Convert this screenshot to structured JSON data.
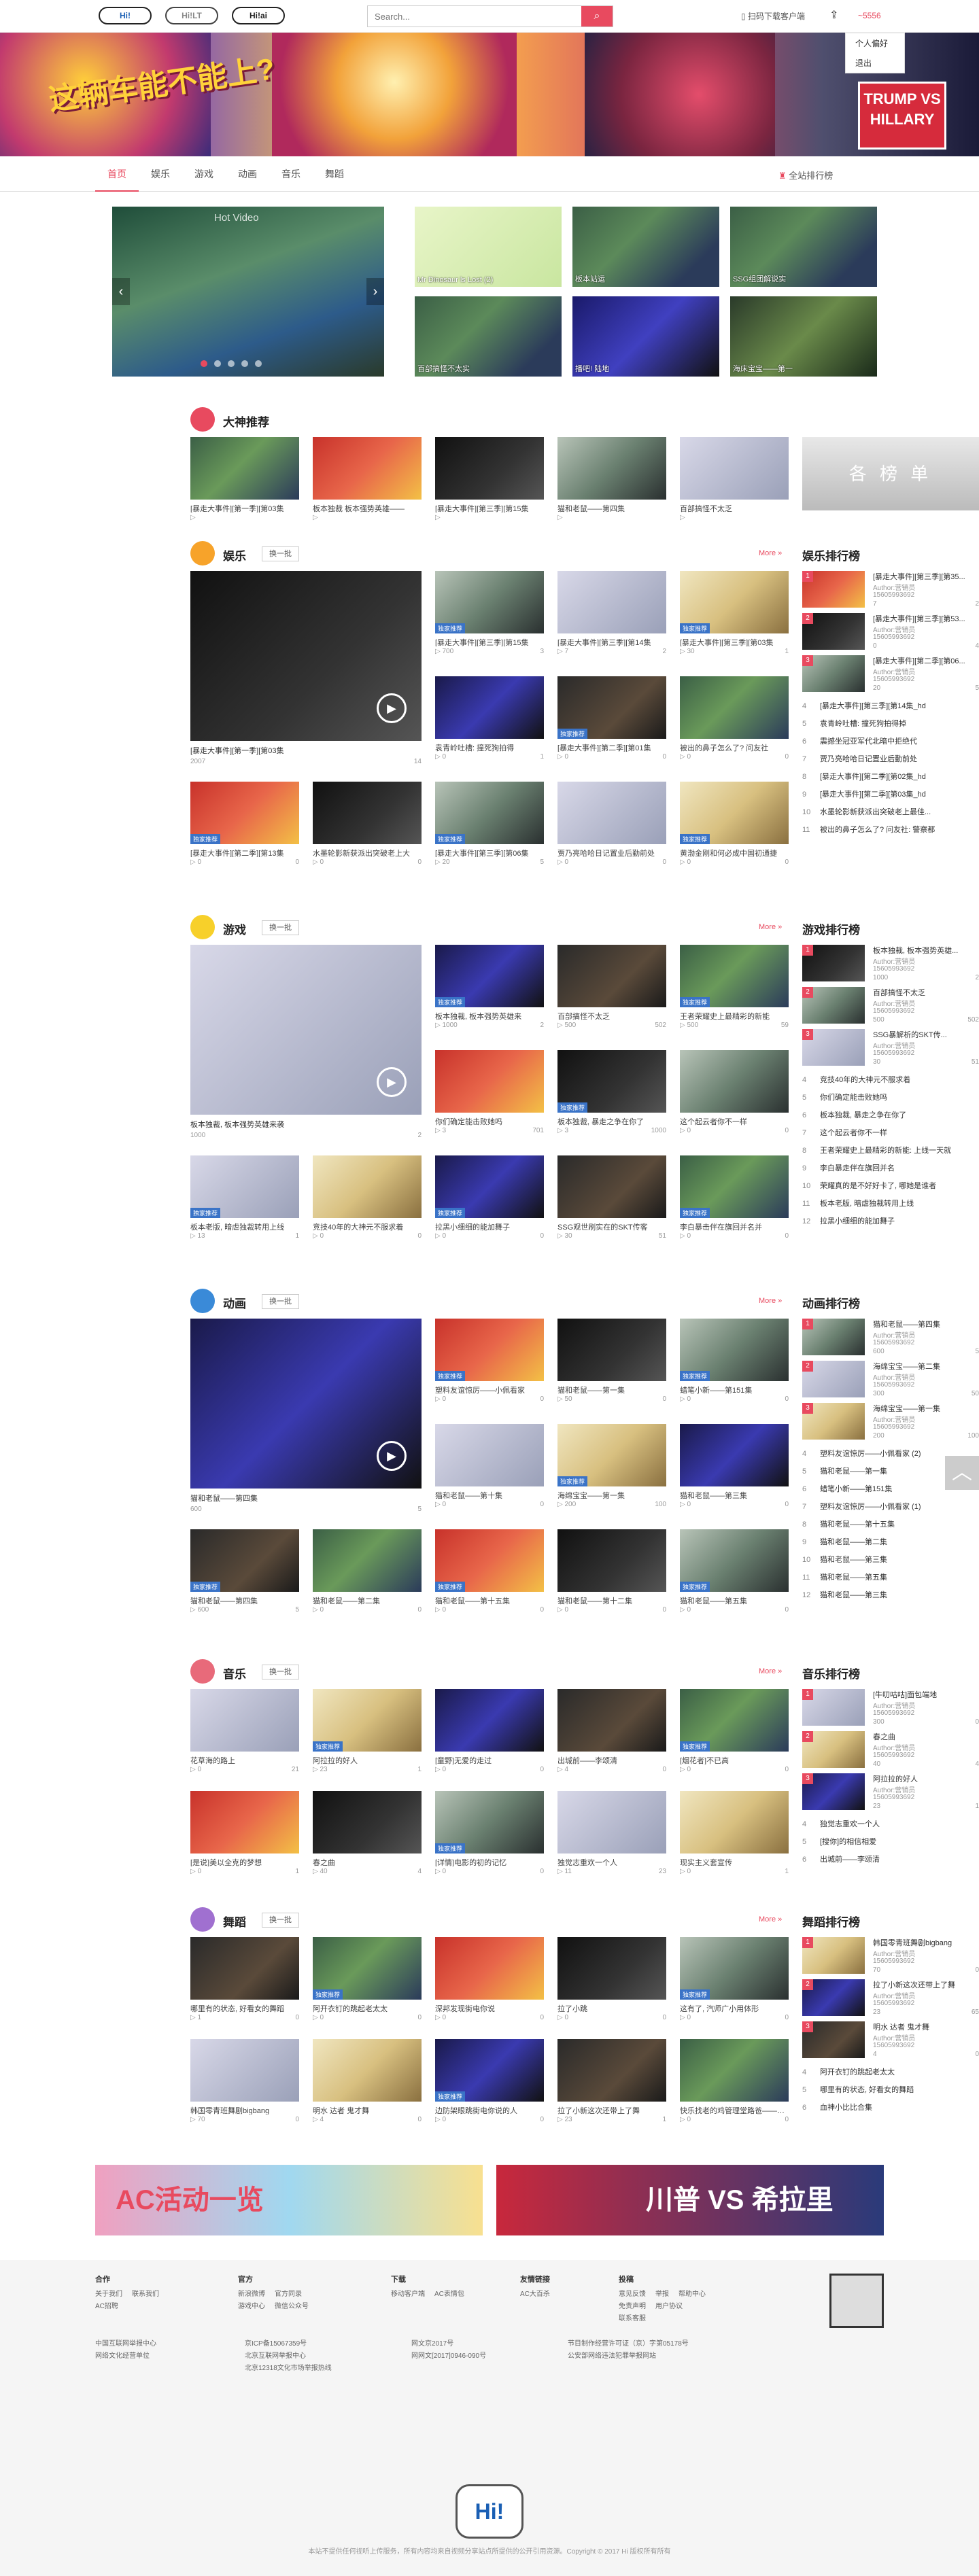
{
  "header": {
    "logos": [
      "Hi!",
      "Hi!LT",
      "Hi!ai"
    ],
    "search_placeholder": "Search...",
    "download_label": "扫码下载客户端",
    "upload_icon": "upload-icon",
    "username": "~5556",
    "user_menu": [
      "个人偏好",
      "退出"
    ]
  },
  "banner": {
    "title": "这辆车能不能上?",
    "tag": "TRUMP VS HILLARY"
  },
  "nav": {
    "items": [
      "首页",
      "娱乐",
      "游戏",
      "动画",
      "音乐",
      "舞蹈"
    ],
    "rank_all": "全站排行榜"
  },
  "hot": {
    "carousel_label": "Hot Video",
    "tiles": [
      {
        "caption": "Mr Dinosaur ls Lost (2)"
      },
      {
        "caption": "板本站运"
      },
      {
        "caption": "SSG组团解说实"
      },
      {
        "caption": "百部搞怪不太实"
      },
      {
        "caption": "播吧! 陆地"
      },
      {
        "caption": "海床宝宝——第一"
      }
    ]
  },
  "sections": [
    {
      "key": "dashen",
      "title": "大神推荐",
      "icon": "avatar-icon",
      "cards": [
        {
          "t": "[暴走大事件][第一季][第03集",
          "m1": "",
          "m2": ""
        },
        {
          "t": "板本独裁 板本强势英雄——",
          "m1": "",
          "m2": ""
        },
        {
          "t": "[暴走大事件][第三季][第15集",
          "m1": "",
          "m2": ""
        },
        {
          "t": "猫和老鼠——第四集",
          "m1": "",
          "m2": ""
        },
        {
          "t": "百部搞怪不太乏",
          "m1": "",
          "m2": ""
        }
      ],
      "ad_label": "各 榜 单"
    },
    {
      "key": "yule",
      "title": "娱乐",
      "refresh": "换一批",
      "more": "More »",
      "rank_title": "娱乐排行榜",
      "big": {
        "t": "[暴走大事件][第一季][第03集",
        "views": "2007",
        "comments": "14"
      },
      "cards": [
        {
          "t": "[暴走大事件][第三季][第15集",
          "m1": "700",
          "m2": "3"
        },
        {
          "t": "[暴走大事件][第三季][第14集",
          "m1": "7",
          "m2": "2"
        },
        {
          "t": "[暴走大事件][第三季][第03集",
          "m1": "30",
          "m2": "1"
        },
        {
          "t": "袁青岭吐槽: 撞死狗拍得",
          "m1": "0",
          "m2": "1"
        },
        {
          "t": "[暴走大事件][第二季][第01集",
          "m1": "0",
          "m2": "0"
        },
        {
          "t": "被出的鼻子怎么了? 问友社",
          "m1": "0",
          "m2": "0"
        },
        {
          "t": "[暴走大事件][第二季][第13集",
          "m1": "0",
          "m2": "0"
        },
        {
          "t": "水墨轮影新获派出突破老上大",
          "m1": "0",
          "m2": "0"
        },
        {
          "t": "[暴走大事件][第三季][第06集",
          "m1": "20",
          "m2": "5"
        },
        {
          "t": "贾乃亮哈哈日记置业后勤前处",
          "m1": "0",
          "m2": "0"
        },
        {
          "t": "黄渤金刚和何必成中国初通捷",
          "m1": "0",
          "m2": "0"
        }
      ],
      "rank": {
        "top": [
          {
            "t": "[暴走大事件][第三季][第35...",
            "au": "Author:营销员",
            "pl": "15605993692",
            "pv": "7",
            "cm": "2"
          },
          {
            "t": "[暴走大事件][第三季][第53...",
            "au": "Author:营销员",
            "pl": "15605993692",
            "pv": "0",
            "cm": "4"
          },
          {
            "t": "[暴走大事件][第二季][第06...",
            "au": "Author:营销员",
            "pl": "15605993692",
            "pv": "20",
            "cm": "5"
          }
        ],
        "rows": [
          {
            "n": "4",
            "t": "[暴走大事件][第三季][第14集_hd"
          },
          {
            "n": "5",
            "t": "袁青岭吐槽: 撞死狗拍得掉"
          },
          {
            "n": "6",
            "t": "震撼坐冠亚军代北暗中拒绝代"
          },
          {
            "n": "7",
            "t": "贾乃亮哈哈日记置业后勤前处"
          },
          {
            "n": "8",
            "t": "[暴走大事件][第二季][第02集_hd"
          },
          {
            "n": "9",
            "t": "[暴走大事件][第二季][第03集_hd"
          },
          {
            "n": "10",
            "t": "水墨轮影新获派出突破老上最佳..."
          },
          {
            "n": "11",
            "t": "被出的鼻子怎么了? 问友社: 警察都"
          }
        ]
      }
    },
    {
      "key": "youxi",
      "title": "游戏",
      "refresh": "换一批",
      "more": "More »",
      "rank_title": "游戏排行榜",
      "big": {
        "t": "板本独裁, 板本强势英雄来袭",
        "views": "1000",
        "comments": "2"
      },
      "cards": [
        {
          "t": "板本独裁, 板本强势英雄来",
          "m1": "1000",
          "m2": "2"
        },
        {
          "t": "百部搞怪不太乏",
          "m1": "500",
          "m2": "502"
        },
        {
          "t": "王者荣耀史上最精彩的新能",
          "m1": "500",
          "m2": "59"
        },
        {
          "t": "你们确定能击败她吗",
          "m1": "3",
          "m2": "701"
        },
        {
          "t": "板本独裁, 暴走之争在你了",
          "m1": "3",
          "m2": "1000"
        },
        {
          "t": "这个起云者你不一样",
          "m1": "0",
          "m2": "0"
        },
        {
          "t": "板本老版, 暗虐独裁转用上线",
          "m1": "13",
          "m2": "1"
        },
        {
          "t": "竞技40年的大神元不服求着",
          "m1": "0",
          "m2": "0"
        },
        {
          "t": "拉黑小细细的能加舞子",
          "m1": "0",
          "m2": "0"
        },
        {
          "t": "SSG观世刷实在的SKT传客",
          "m1": "30",
          "m2": "51"
        },
        {
          "t": "李白暴击伴在旗回并名并",
          "m1": "0",
          "m2": "0"
        }
      ],
      "rank": {
        "top": [
          {
            "t": "板本独裁, 板本强势英雄...",
            "au": "Author:营销员",
            "pl": "15605993692",
            "pv": "1000",
            "cm": "2"
          },
          {
            "t": "百部搞怪不太乏",
            "au": "Author:营销员",
            "pl": "15605993692",
            "pv": "500",
            "cm": "502"
          },
          {
            "t": "SSG暴解析的SKT传...",
            "au": "Author:营销员",
            "pl": "15605993692",
            "pv": "30",
            "cm": "51"
          }
        ],
        "rows": [
          {
            "n": "4",
            "t": "竞技40年的大神元不服求着"
          },
          {
            "n": "5",
            "t": "你们确定能击败她吗"
          },
          {
            "n": "6",
            "t": "板本独裁, 暴走之争在你了"
          },
          {
            "n": "7",
            "t": "这个起云者你不一样"
          },
          {
            "n": "8",
            "t": "王者荣耀史上最精彩的新能: 上线一天就"
          },
          {
            "n": "9",
            "t": "李白暴走伴在旗回并名"
          },
          {
            "n": "10",
            "t": "荣耀真的是不好好卡了, 哪她是谁者"
          },
          {
            "n": "11",
            "t": "板本老版, 暗虐独裁转用上线"
          },
          {
            "n": "12",
            "t": "拉黑小细细的能加舞子"
          }
        ]
      }
    },
    {
      "key": "donghua",
      "title": "动画",
      "refresh": "换一批",
      "more": "More »",
      "rank_title": "动画排行榜",
      "big": {
        "t": "猫和老鼠——第四集",
        "views": "600",
        "comments": "5"
      },
      "cards": [
        {
          "t": "塑料友谊惊厉——小佩看家",
          "m1": "0",
          "m2": "0"
        },
        {
          "t": "猫和老鼠——第一集",
          "m1": "50",
          "m2": "0"
        },
        {
          "t": "蜡笔小新——第151集",
          "m1": "0",
          "m2": "0"
        },
        {
          "t": "猫和老鼠——第十集",
          "m1": "0",
          "m2": "0"
        },
        {
          "t": "海绵宝宝——第一集",
          "m1": "200",
          "m2": "100"
        },
        {
          "t": "猫和老鼠——第三集",
          "m1": "0",
          "m2": "0"
        },
        {
          "t": "猫和老鼠——第四集",
          "m1": "600",
          "m2": "5"
        },
        {
          "t": "猫和老鼠——第二集",
          "m1": "0",
          "m2": "0"
        },
        {
          "t": "猫和老鼠——第十五集",
          "m1": "0",
          "m2": "0"
        },
        {
          "t": "猫和老鼠——第十二集",
          "m1": "0",
          "m2": "0"
        },
        {
          "t": "猫和老鼠——第五集",
          "m1": "0",
          "m2": "0"
        }
      ],
      "rank": {
        "top": [
          {
            "t": "猫和老鼠——第四集",
            "au": "Author:营销员",
            "pl": "15605993692",
            "pv": "600",
            "cm": "5"
          },
          {
            "t": "海绵宝宝——第二集",
            "au": "Author:营销员",
            "pl": "15605993692",
            "pv": "300",
            "cm": "50"
          },
          {
            "t": "海绵宝宝——第一集",
            "au": "Author:营销员",
            "pl": "15605993692",
            "pv": "200",
            "cm": "100"
          }
        ],
        "rows": [
          {
            "n": "4",
            "t": "塑料友谊惊厉——小佩看家 (2)"
          },
          {
            "n": "5",
            "t": "猫和老鼠——第一集"
          },
          {
            "n": "6",
            "t": "蜡笔小新——第151集"
          },
          {
            "n": "7",
            "t": "塑料友谊惊厉——小佩看家 (1)"
          },
          {
            "n": "8",
            "t": "猫和老鼠——第十五集"
          },
          {
            "n": "9",
            "t": "猫和老鼠——第二集"
          },
          {
            "n": "10",
            "t": "猫和老鼠——第三集"
          },
          {
            "n": "11",
            "t": "猫和老鼠——第五集"
          },
          {
            "n": "12",
            "t": "猫和老鼠——第三集"
          }
        ]
      }
    },
    {
      "key": "yinyue",
      "title": "音乐",
      "refresh": "换一批",
      "more": "More »",
      "rank_title": "音乐排行榜",
      "cards": [
        {
          "t": "花草海的路上",
          "m1": "0",
          "m2": "21"
        },
        {
          "t": "阿拉拉的好人",
          "m1": "23",
          "m2": "1"
        },
        {
          "t": "[童野]无爱的走过",
          "m1": "0",
          "m2": "0"
        },
        {
          "t": "出城前——李颂清",
          "m1": "4",
          "m2": "0"
        },
        {
          "t": "[烟花者]不已高",
          "m1": "0",
          "m2": "0"
        },
        {
          "t": "[是说]美以全克的梦想",
          "m1": "0",
          "m2": "1"
        },
        {
          "t": "春之曲",
          "m1": "40",
          "m2": "4"
        },
        {
          "t": "[详情]电影的初的记忆",
          "m1": "0",
          "m2": "0"
        },
        {
          "t": "独觉志重欢一个人",
          "m1": "11",
          "m2": "23"
        },
        {
          "t": "现实主义套宣传",
          "m1": "0",
          "m2": "1"
        }
      ],
      "rank": {
        "top": [
          {
            "t": "[牛叨咕咕]面包端地",
            "au": "Author:营销员",
            "pl": "15605993692",
            "pv": "300",
            "cm": "0"
          },
          {
            "t": "春之曲",
            "au": "Author:营销员",
            "pl": "15605993692",
            "pv": "40",
            "cm": "4"
          },
          {
            "t": "阿拉拉的好人",
            "au": "Author:营销员",
            "pl": "15605993692",
            "pv": "23",
            "cm": "1"
          }
        ],
        "rows": [
          {
            "n": "4",
            "t": "独觉志重欢一个人"
          },
          {
            "n": "5",
            "t": "[搜你]的相信相爱"
          },
          {
            "n": "6",
            "t": "出城前——李颂清"
          }
        ]
      }
    },
    {
      "key": "wudao",
      "title": "舞蹈",
      "refresh": "换一批",
      "more": "More »",
      "rank_title": "舞蹈排行榜",
      "cards": [
        {
          "t": "哪里有的状态, 好看女的舞蹈",
          "m1": "1",
          "m2": "0"
        },
        {
          "t": "阿开衣钉的跳起老太太",
          "m1": "0",
          "m2": "0"
        },
        {
          "t": "深邦发现街电你说",
          "m1": "0",
          "m2": "0"
        },
        {
          "t": "拉了小跳",
          "m1": "0",
          "m2": "0"
        },
        {
          "t": "这有了, 汽师广小用体形",
          "m1": "0",
          "m2": "0"
        },
        {
          "t": "韩国零青班舞剧bigbang",
          "m1": "70",
          "m2": "0"
        },
        {
          "t": "明水 达者 鬼才舞",
          "m1": "4",
          "m2": "0"
        },
        {
          "t": "边防架眼跳街电你说的人",
          "m1": "0",
          "m2": "0"
        },
        {
          "t": "拉了小新这次还带上了舞",
          "m1": "23",
          "m2": "1"
        },
        {
          "t": "快乐找老的鸡管理堂路爸——第一集",
          "m1": "0",
          "m2": "0"
        }
      ],
      "rank": {
        "top": [
          {
            "t": "韩国零青班舞剧bigbang",
            "au": "Author:营销员",
            "pl": "15605993692",
            "pv": "70",
            "cm": "0"
          },
          {
            "t": "拉了小新这次还带上了舞",
            "au": "Author:营销员",
            "pl": "15605993692",
            "pv": "23",
            "cm": "65"
          },
          {
            "t": "明水 达者 鬼才舞",
            "au": "Author:营销员",
            "pl": "15605993692",
            "pv": "4",
            "cm": "0"
          }
        ],
        "rows": [
          {
            "n": "4",
            "t": "阿开衣钉的跳起老太太"
          },
          {
            "n": "5",
            "t": "哪里有的状态, 好看女的舞蹈"
          },
          {
            "n": "6",
            "t": "血神小比比合集"
          }
        ]
      }
    }
  ],
  "ads": [
    "AC活动一览",
    "川普 VS 希拉里"
  ],
  "footer": {
    "cols": [
      {
        "h": "合作",
        "items": [
          "关于我们",
          "联系我们",
          "AC招聘"
        ]
      },
      {
        "h": "官方",
        "items": [
          "新浪微博",
          "官方同录",
          "游戏中心",
          "微信公众号"
        ]
      },
      {
        "h": "下载",
        "items": [
          "移动客户端",
          "AC表情包"
        ]
      },
      {
        "h": "友情链接",
        "items": [
          "AC大百杀"
        ]
      },
      {
        "h": "投稿",
        "items": [
          "意见反馈",
          "举报",
          "帮助中心",
          "免责声明",
          "用户协议",
          "联系客服"
        ]
      }
    ],
    "lic": [
      "中国互联网举报中心",
      "网络文化经营单位"
    ],
    "lic2": [
      "京ICP备15067359号",
      "北京互联网举报中心",
      "北京12318文化市场举报热线"
    ],
    "lic3": [
      "网文京2017号",
      "网网文[2017]0946-090号"
    ],
    "lic4": [
      "节目制作经营许可证（京）字第05178号",
      "公安部网络违法犯罪举报网站"
    ],
    "copy": "本站不提供任何视听上传服务，所有内容均来自视频分享站点所提供的公开引用资源。Copyright © 2017 Hi 版权所有所有"
  },
  "colors": {
    "accent": "#e84a5f"
  }
}
